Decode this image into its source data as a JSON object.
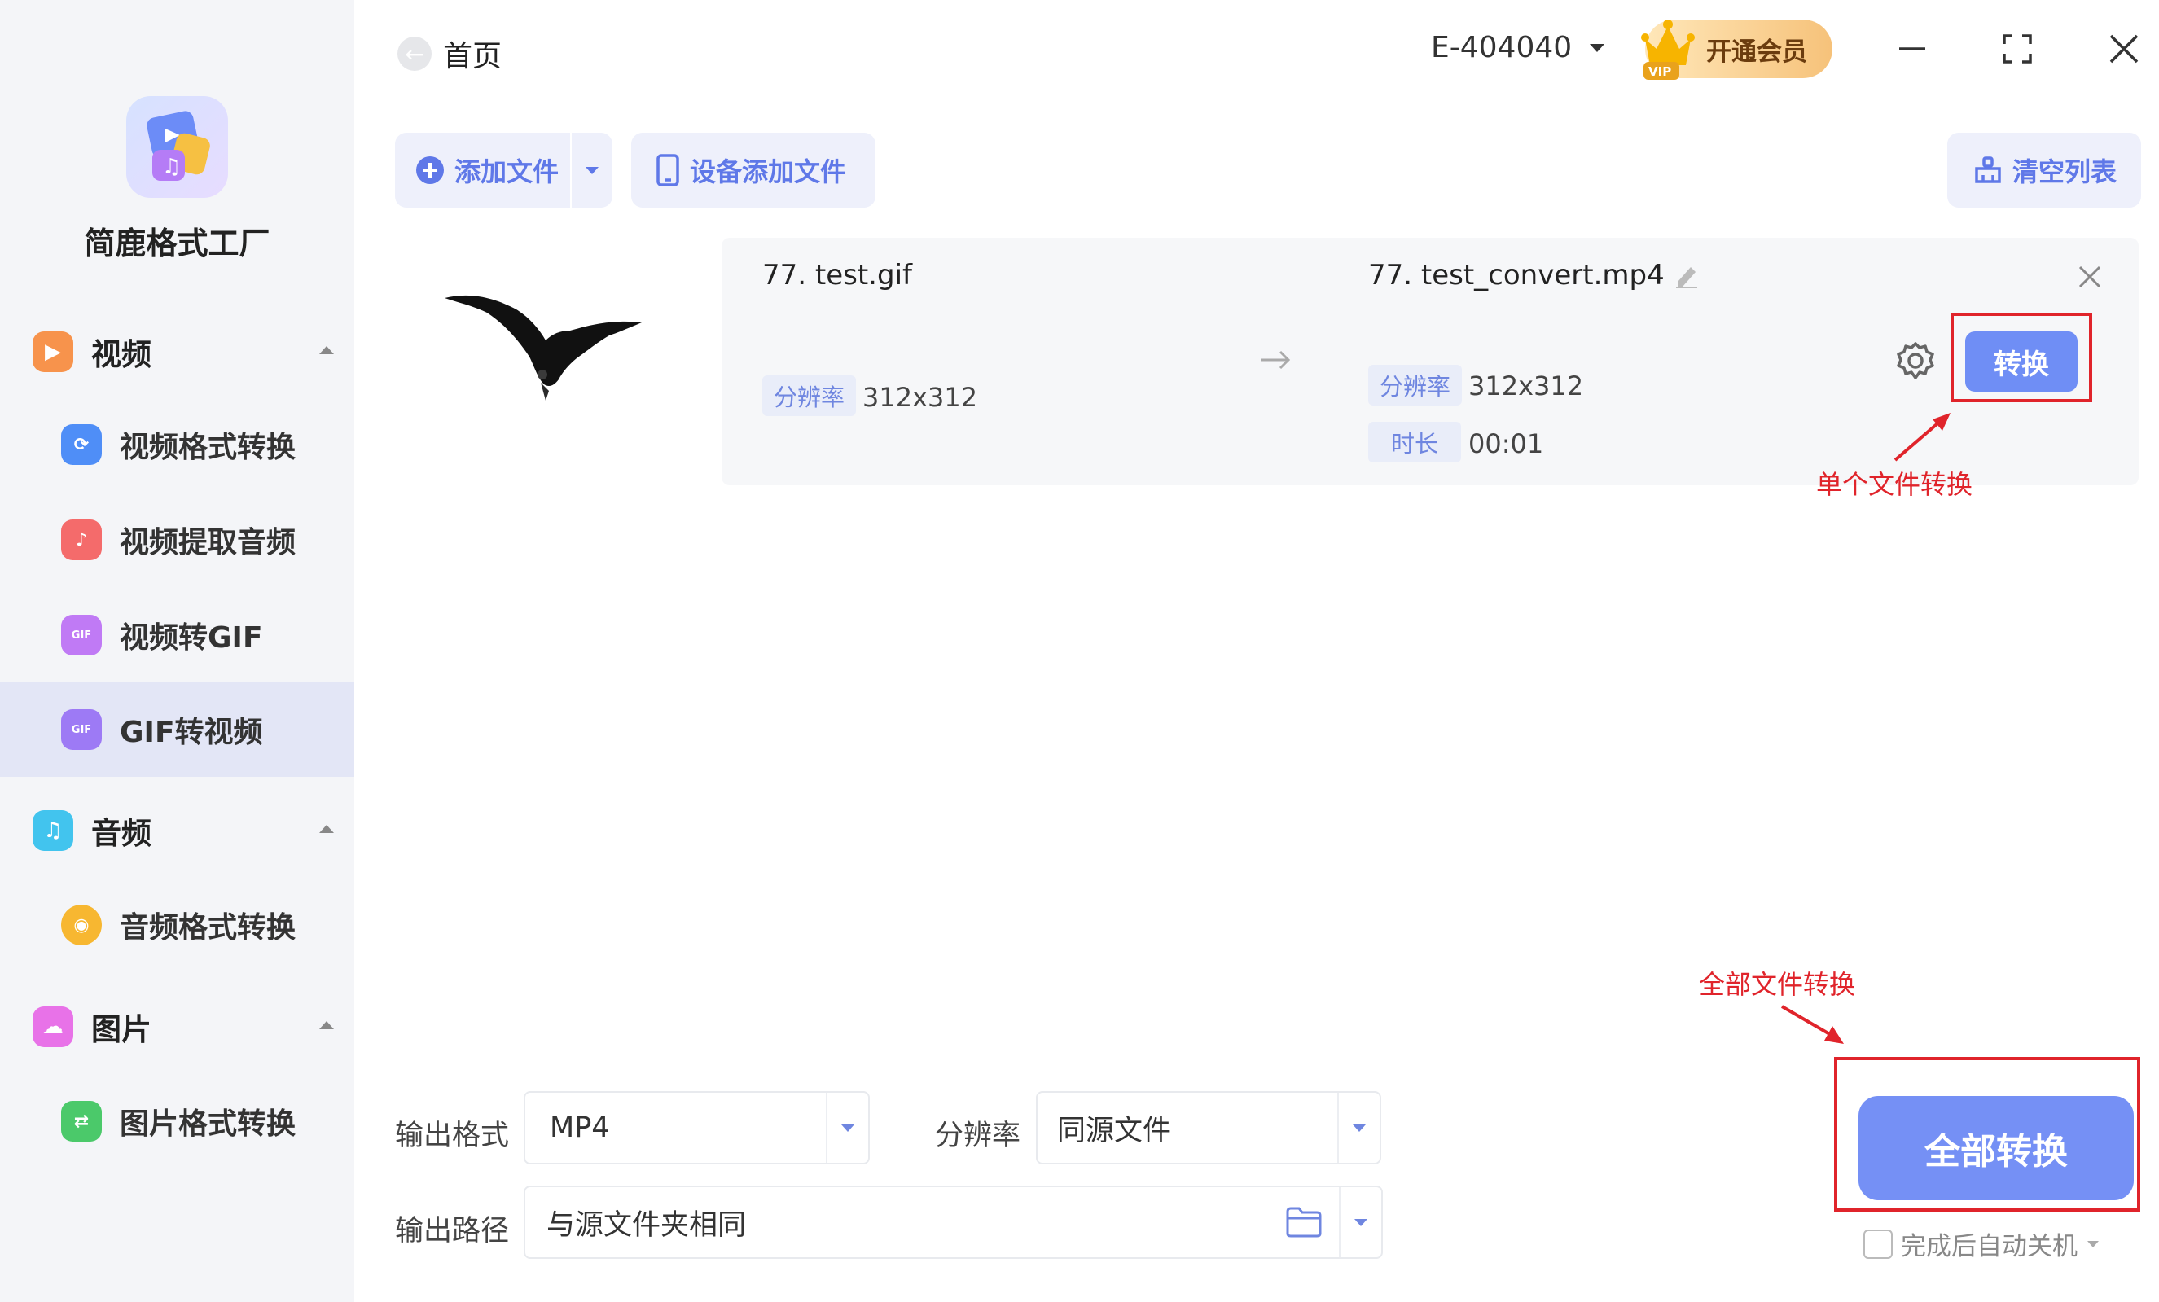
{
  "app": {
    "name": "简鹿格式工厂"
  },
  "sidebar": {
    "groups": [
      {
        "label": "视频",
        "icon": "video-icon",
        "color": "#f7934c"
      },
      {
        "label": "音频",
        "icon": "music-icon",
        "color": "#42c4ee"
      },
      {
        "label": "图片",
        "icon": "image-icon",
        "color": "#e872e8"
      }
    ],
    "items": [
      {
        "label": "视频格式转换",
        "icon": "video-convert-icon",
        "color": "#4f8ef7"
      },
      {
        "label": "视频提取音频",
        "icon": "extract-audio-icon",
        "color": "#f46b6b"
      },
      {
        "label": "视频转GIF",
        "icon": "video-to-gif-icon",
        "color": "#c07af5",
        "badge": "GIF"
      },
      {
        "label": "GIF转视频",
        "icon": "gif-to-video-icon",
        "color": "#9d7af5",
        "badge": "GIF",
        "active": true
      },
      {
        "label": "音频格式转换",
        "icon": "audio-convert-icon",
        "color": "#f7b731"
      },
      {
        "label": "图片格式转换",
        "icon": "image-convert-icon",
        "color": "#4bc96a"
      }
    ]
  },
  "header": {
    "back_label": "首页",
    "account": "E-404040",
    "vip_label": "开通会员",
    "vip_badge": "VIP"
  },
  "toolbar": {
    "add_file": "添加文件",
    "device_add": "设备添加文件",
    "clear_list": "清空列表"
  },
  "file": {
    "source_name": "77. test.gif",
    "source_resolution_label": "分辨率",
    "source_resolution": "312x312",
    "output_name": "77. test_convert.mp4",
    "output_resolution_label": "分辨率",
    "output_resolution": "312x312",
    "duration_label": "时长",
    "duration": "00:01",
    "convert_button": "转换"
  },
  "annotations": {
    "single": "单个文件转换",
    "all": "全部文件转换"
  },
  "settings": {
    "format_label": "输出格式",
    "format_value": "MP4",
    "resolution_label": "分辨率",
    "resolution_value": "同源文件",
    "path_label": "输出路径",
    "path_value": "与源文件夹相同"
  },
  "footer": {
    "convert_all": "全部转换",
    "auto_shutdown": "完成后自动关机"
  },
  "colors": {
    "accent": "#6f8ef5",
    "annotation": "#e0242b"
  }
}
